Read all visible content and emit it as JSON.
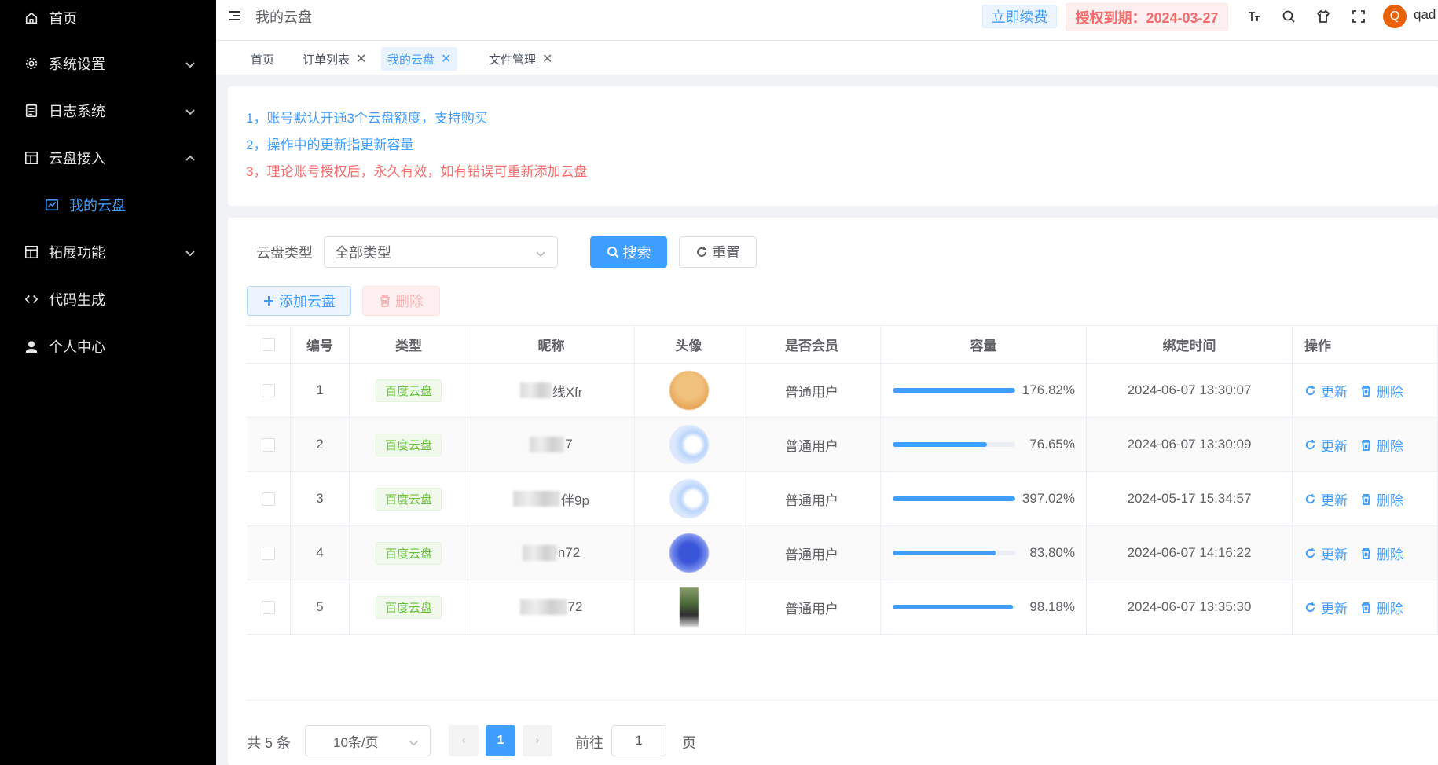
{
  "sidebar": {
    "items": [
      {
        "label": "首页",
        "icon": "home-icon"
      },
      {
        "label": "系统设置",
        "icon": "gear-icon",
        "arrow": "down"
      },
      {
        "label": "日志系统",
        "icon": "document-icon",
        "arrow": "down"
      },
      {
        "label": "云盘接入",
        "icon": "layout-icon",
        "arrow": "up"
      },
      {
        "label": "我的云盘",
        "icon": "chart-icon",
        "active": true
      },
      {
        "label": "拓展功能",
        "icon": "layout-icon",
        "arrow": "down"
      },
      {
        "label": "代码生成",
        "icon": "code-icon"
      },
      {
        "label": "个人中心",
        "icon": "user-icon"
      }
    ]
  },
  "header": {
    "breadcrumb": "我的云盘",
    "renew_label": "立即续费",
    "auth_label": "授权到期：2024-03-27",
    "avatar_letter": "Q",
    "username": "qad",
    "tools": [
      "font-size-icon",
      "search-icon",
      "shirt-icon",
      "fullscreen-icon"
    ]
  },
  "tags": [
    {
      "label": "首页",
      "closable": false
    },
    {
      "label": "订单列表",
      "closable": true
    },
    {
      "label": "我的云盘",
      "closable": true,
      "active": true
    },
    {
      "label": "文件管理",
      "closable": true
    }
  ],
  "notice": [
    "1，账号默认开通3个云盘额度，支持购买",
    "2，操作中的更新指更新容量",
    "3，理论账号授权后，永久有效，如有错误可重新添加云盘"
  ],
  "filter": {
    "label": "云盘类型",
    "value": "全部类型",
    "search_label": "搜索",
    "reset_label": "重置",
    "add_label": "添加云盘",
    "delete_label": "删除"
  },
  "table": {
    "headers": [
      "编号",
      "类型",
      "昵称",
      "头像",
      "是否会员",
      "容量",
      "绑定时间",
      "操作"
    ],
    "rows": [
      {
        "id": "1",
        "type": "百度云盘",
        "nick_visible": "线Xfr",
        "member": "普通用户",
        "capacity": "176.82%",
        "fill": 1.0,
        "time": "2024-06-07 13:30:07"
      },
      {
        "id": "2",
        "type": "百度云盘",
        "nick_visible": "7",
        "member": "普通用户",
        "capacity": "76.65%",
        "fill": 0.7665,
        "time": "2024-06-07 13:30:09"
      },
      {
        "id": "3",
        "type": "百度云盘",
        "nick_visible": "伴9p",
        "member": "普通用户",
        "capacity": "397.02%",
        "fill": 1.0,
        "time": "2024-05-17 15:34:57"
      },
      {
        "id": "4",
        "type": "百度云盘",
        "nick_visible": "n72",
        "member": "普通用户",
        "capacity": "83.80%",
        "fill": 0.838,
        "time": "2024-06-07 14:16:22"
      },
      {
        "id": "5",
        "type": "百度云盘",
        "nick_visible": "72",
        "member": "普通用户",
        "capacity": "98.18%",
        "fill": 0.9818,
        "time": "2024-06-07 13:35:30"
      }
    ],
    "update_label": "更新",
    "delete_label": "删除"
  },
  "pagination": {
    "total": "共 5 条",
    "page_size": "10条/页",
    "prev": "‹",
    "current": "1",
    "next": "›",
    "goto_label": "前往",
    "goto_value": "1",
    "page_suffix": "页"
  },
  "colors": {
    "primary": "#409eff",
    "danger": "#f56c6c",
    "success": "#67c23a",
    "sidebar_bg": "#000000"
  }
}
